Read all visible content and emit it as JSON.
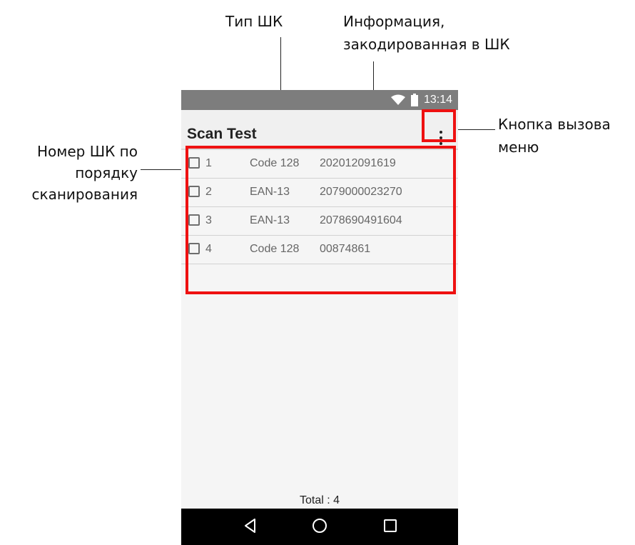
{
  "annotations": {
    "barcode_type": "Тип ШК",
    "encoded_info_line1": "Информация,",
    "encoded_info_line2": "закодированная в ШК",
    "scan_number_line1": "Номер ШК по",
    "scan_number_line2": "порядку",
    "scan_number_line3": "сканирования",
    "menu_button_line1": "Кнопка вызова",
    "menu_button_line2": "меню"
  },
  "phone": {
    "status_bar": {
      "time": "13:14",
      "icons": [
        "wifi-icon",
        "battery-icon"
      ]
    },
    "app_bar": {
      "title": "Scan Test",
      "menu_icon": "more-vert-icon"
    },
    "scans": [
      {
        "number": "1",
        "type": "Code 128",
        "data": "202012091619",
        "checked": false
      },
      {
        "number": "2",
        "type": "EAN-13",
        "data": "2079000023270",
        "checked": false
      },
      {
        "number": "3",
        "type": "EAN-13",
        "data": "2078690491604",
        "checked": false
      },
      {
        "number": "4",
        "type": "Code 128",
        "data": "00874861",
        "checked": false
      }
    ],
    "total": "Total : 4",
    "nav_bar": {
      "icons": [
        "back-icon",
        "home-icon",
        "recents-icon"
      ]
    }
  },
  "colors": {
    "highlight": "#ee1111",
    "status_bar": "#7d7d7d",
    "app_bar": "#f0f0f0",
    "nav_bar": "#000000"
  }
}
